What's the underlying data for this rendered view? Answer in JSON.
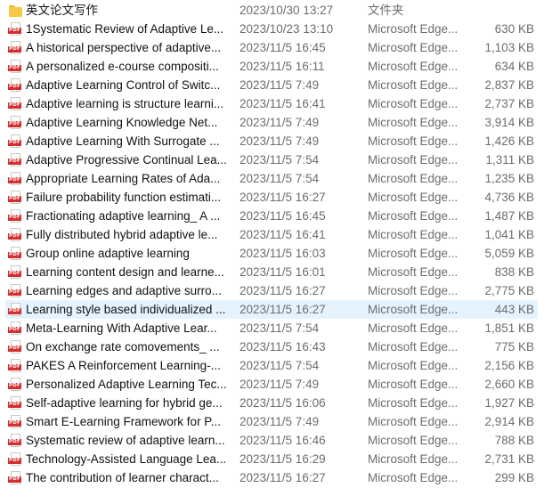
{
  "colors": {
    "folder": "#f7c948",
    "pdf_tag": "#d32f2f",
    "selected_row": "#e5f3ff"
  },
  "pdf_icon_text": "PDF",
  "rows": [
    {
      "icon": "folder-icon",
      "name": "英文论文写作",
      "date": "2023/10/30 13:27",
      "type": "文件夹",
      "size": "",
      "selected": false
    },
    {
      "icon": "pdf-icon",
      "name": "1Systematic Review of Adaptive Le...",
      "date": "2023/10/23 13:10",
      "type": "Microsoft Edge...",
      "size": "630 KB",
      "selected": false
    },
    {
      "icon": "pdf-icon",
      "name": "A historical perspective of adaptive...",
      "date": "2023/11/5 16:45",
      "type": "Microsoft Edge...",
      "size": "1,103 KB",
      "selected": false
    },
    {
      "icon": "pdf-icon",
      "name": "A personalized e-course compositi...",
      "date": "2023/11/5 16:11",
      "type": "Microsoft Edge...",
      "size": "634 KB",
      "selected": false
    },
    {
      "icon": "pdf-icon",
      "name": "Adaptive Learning Control of Switc...",
      "date": "2023/11/5 7:49",
      "type": "Microsoft Edge...",
      "size": "2,837 KB",
      "selected": false
    },
    {
      "icon": "pdf-icon",
      "name": "Adaptive learning is structure learni...",
      "date": "2023/11/5 16:41",
      "type": "Microsoft Edge...",
      "size": "2,737 KB",
      "selected": false
    },
    {
      "icon": "pdf-icon",
      "name": "Adaptive Learning Knowledge Net...",
      "date": "2023/11/5 7:49",
      "type": "Microsoft Edge...",
      "size": "3,914 KB",
      "selected": false
    },
    {
      "icon": "pdf-icon",
      "name": "Adaptive Learning With Surrogate ...",
      "date": "2023/11/5 7:49",
      "type": "Microsoft Edge...",
      "size": "1,426 KB",
      "selected": false
    },
    {
      "icon": "pdf-icon",
      "name": "Adaptive Progressive Continual Lea...",
      "date": "2023/11/5 7:54",
      "type": "Microsoft Edge...",
      "size": "1,311 KB",
      "selected": false
    },
    {
      "icon": "pdf-icon",
      "name": "Appropriate Learning Rates of Ada...",
      "date": "2023/11/5 7:54",
      "type": "Microsoft Edge...",
      "size": "1,235 KB",
      "selected": false
    },
    {
      "icon": "pdf-icon",
      "name": "Failure probability function estimati...",
      "date": "2023/11/5 16:27",
      "type": "Microsoft Edge...",
      "size": "4,736 KB",
      "selected": false
    },
    {
      "icon": "pdf-icon",
      "name": "Fractionating adaptive learning_ A ...",
      "date": "2023/11/5 16:45",
      "type": "Microsoft Edge...",
      "size": "1,487 KB",
      "selected": false
    },
    {
      "icon": "pdf-icon",
      "name": "Fully distributed hybrid adaptive le...",
      "date": "2023/11/5 16:41",
      "type": "Microsoft Edge...",
      "size": "1,041 KB",
      "selected": false
    },
    {
      "icon": "pdf-icon",
      "name": "Group online adaptive learning",
      "date": "2023/11/5 16:03",
      "type": "Microsoft Edge...",
      "size": "5,059 KB",
      "selected": false
    },
    {
      "icon": "pdf-icon",
      "name": "Learning content design and learne...",
      "date": "2023/11/5 16:01",
      "type": "Microsoft Edge...",
      "size": "838 KB",
      "selected": false
    },
    {
      "icon": "pdf-icon",
      "name": "Learning edges and adaptive surro...",
      "date": "2023/11/5 16:27",
      "type": "Microsoft Edge...",
      "size": "2,775 KB",
      "selected": false
    },
    {
      "icon": "pdf-icon",
      "name": "Learning style based individualized ...",
      "date": "2023/11/5 16:27",
      "type": "Microsoft Edge...",
      "size": "443 KB",
      "selected": true
    },
    {
      "icon": "pdf-icon",
      "name": "Meta-Learning With Adaptive Lear...",
      "date": "2023/11/5 7:54",
      "type": "Microsoft Edge...",
      "size": "1,851 KB",
      "selected": false
    },
    {
      "icon": "pdf-icon",
      "name": "On exchange rate comovements_ ...",
      "date": "2023/11/5 16:43",
      "type": "Microsoft Edge...",
      "size": "775 KB",
      "selected": false
    },
    {
      "icon": "pdf-icon",
      "name": "PAKES A Reinforcement Learning-...",
      "date": "2023/11/5 7:54",
      "type": "Microsoft Edge...",
      "size": "2,156 KB",
      "selected": false
    },
    {
      "icon": "pdf-icon",
      "name": "Personalized Adaptive Learning Tec...",
      "date": "2023/11/5 7:49",
      "type": "Microsoft Edge...",
      "size": "2,660 KB",
      "selected": false
    },
    {
      "icon": "pdf-icon",
      "name": "Self-adaptive learning for hybrid ge...",
      "date": "2023/11/5 16:06",
      "type": "Microsoft Edge...",
      "size": "1,927 KB",
      "selected": false
    },
    {
      "icon": "pdf-icon",
      "name": "Smart E-Learning Framework for P...",
      "date": "2023/11/5 7:49",
      "type": "Microsoft Edge...",
      "size": "2,914 KB",
      "selected": false
    },
    {
      "icon": "pdf-icon",
      "name": "Systematic review of adaptive learn...",
      "date": "2023/11/5 16:46",
      "type": "Microsoft Edge...",
      "size": "788 KB",
      "selected": false
    },
    {
      "icon": "pdf-icon",
      "name": "Technology-Assisted Language Lea...",
      "date": "2023/11/5 16:29",
      "type": "Microsoft Edge...",
      "size": "2,731 KB",
      "selected": false
    },
    {
      "icon": "pdf-icon",
      "name": "The contribution of learner charact...",
      "date": "2023/11/5 16:27",
      "type": "Microsoft Edge...",
      "size": "299 KB",
      "selected": false
    }
  ]
}
